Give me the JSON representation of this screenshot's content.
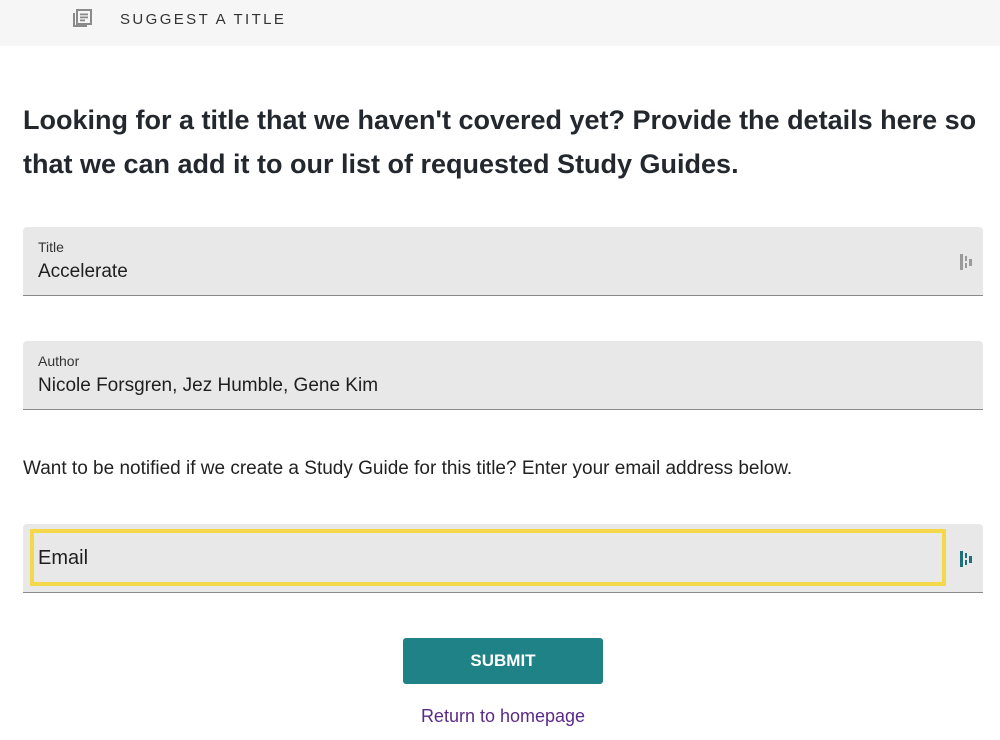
{
  "header": {
    "icon": "library-books-icon",
    "label": "SUGGEST A TITLE"
  },
  "main": {
    "heading": "Looking for a title that we haven't covered yet? Provide the details here so that we can add it to our list of requested Study Guides.",
    "title_field": {
      "label": "Title",
      "value": "Accelerate",
      "icon": "password-manager-icon"
    },
    "author_field": {
      "label": "Author",
      "value": "Nicole Forsgren, Jez Humble, Gene Kim"
    },
    "notice": "Want to be notified if we create a Study Guide for this title? Enter your email address below.",
    "email_field": {
      "placeholder": "Email",
      "value": "",
      "icon": "password-manager-icon",
      "icon_color": "#1e6f78"
    },
    "submit_label": "SUBMIT",
    "return_link": "Return to homepage"
  },
  "colors": {
    "accent": "#1e8287",
    "link": "#5b2a86",
    "focus_highlight": "#f5d84a",
    "field_bg": "#e8e8e8"
  }
}
